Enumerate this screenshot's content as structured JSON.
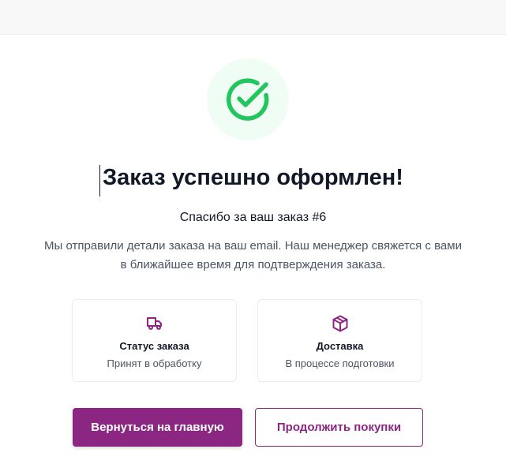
{
  "colors": {
    "accent": "#8b2783",
    "success": "#22c55e",
    "success_bg": "#f0fdf4"
  },
  "success_icon": "check-circle-icon",
  "title": "Заказ успешно оформлен!",
  "subtitle": "Спасибо за ваш заказ #6",
  "description": "Мы отправили детали заказа на ваш email. Наш менеджер свяжется с вами в ближайшее время для подтверждения заказа.",
  "cards": [
    {
      "icon": "truck-icon",
      "title": "Статус заказа",
      "text": "Принят в обработку"
    },
    {
      "icon": "package-icon",
      "title": "Доставка",
      "text": "В процессе подготовки"
    }
  ],
  "buttons": {
    "home": "Вернуться на главную",
    "continue": "Продолжить покупки"
  }
}
